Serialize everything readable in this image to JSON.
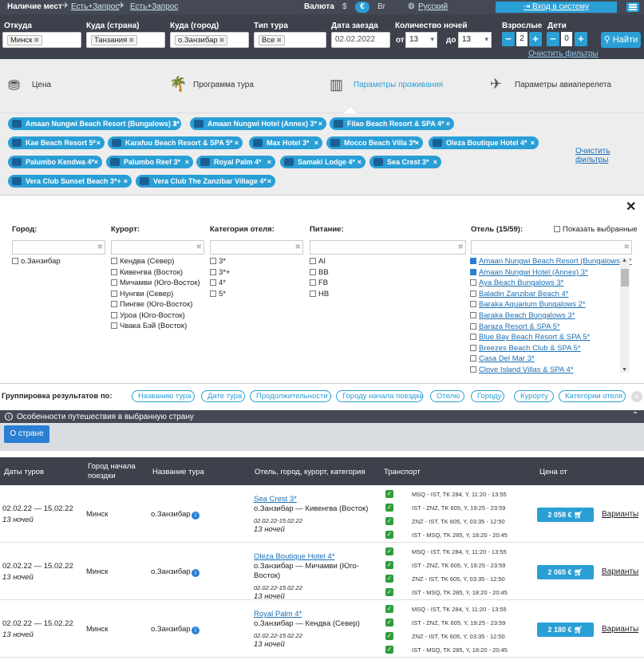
{
  "topbar": {
    "availability_label": "Наличие мест",
    "avail1": "Есть+Запрос",
    "avail2": "Есть+Запрос",
    "currency_label": "Валюта",
    "cur_usd": "$",
    "cur_eur": "€",
    "cur_br": "Br",
    "language": "Русский",
    "login": "Вход в систему"
  },
  "filters": {
    "from_label": "Откуда",
    "from_value": "Минск",
    "country_label": "Куда (страна)",
    "country_value": "Танзания",
    "city_label": "Куда (город)",
    "city_value": "о.Занзибар",
    "tour_type_label": "Тип тура",
    "tour_type_value": "Все",
    "date_label": "Дата заезда",
    "date_value": "02.02.2022",
    "nights_label": "Количество ночей",
    "nights_from_label": "от",
    "nights_from": "13",
    "nights_to_label": "до",
    "nights_to": "13",
    "adults_label": "Взрослые",
    "adults_value": "2",
    "children_label": "Дети",
    "children_value": "0",
    "minus": "−",
    "plus": "+",
    "find": "Найти",
    "clear": "Очистить фильтры"
  },
  "tabs": [
    {
      "label": "Цена"
    },
    {
      "label": "Программа тура"
    },
    {
      "label": "Параметры проживания"
    },
    {
      "label": "Параметры авиаперелета"
    }
  ],
  "hotel_tags": [
    "Amaan Nungwi Beach Resort (Bungalows) 3*",
    "Amaan Nungwi Hotel (Annex) 3*",
    "Filao Beach Resort & SPA 4*",
    "Kae Beach Resort 5*",
    "Karafuu Beach Resort & SPA 5*",
    "Max Hotel 3*",
    "Mocco Beach Villa 3*",
    "Oleza Boutique Hotel 4*",
    "Palumbo Kendwa 4*",
    "Palumbo Reef 3*",
    "Royal Palm 4*",
    "Samaki Lodge 4*",
    "Sea Crest 3*",
    "Vera Club Sunset Beach 3*+",
    "Vera Club The Zanzibar Village 4*"
  ],
  "tag_close": "×",
  "clear_filters": "Очистить фильтры",
  "panel": {
    "close": "✕",
    "city_label": "Город:",
    "cities": [
      "о.Занзибар"
    ],
    "resort_label": "Курорт:",
    "resorts": [
      "Кендва (Север)",
      "Кивенгва (Восток)",
      "Мичамви (Юго-Восток)",
      "Нунгви (Север)",
      "Пингве (Юго-Восток)",
      "Уроа (Юго-Восток)",
      "Чвака Бэй (Восток)"
    ],
    "category_label": "Категория отеля:",
    "categories": [
      "3*",
      "3*+",
      "4*",
      "5*"
    ],
    "meal_label": "Питание:",
    "meals": [
      "AI",
      "BB",
      "FB",
      "HB"
    ],
    "hotel_label": "Отель (15/59):",
    "show_selected": "Показать выбранные",
    "hotels": [
      "Amaan Nungwi Beach Resort (Bungalows) 3*",
      "Amaan Nungwi Hotel (Annex) 3*",
      "Aya Beach Bungalows 3*",
      "Baladin Zanzibar Beach 4*",
      "Baraka Aquarium Bungalows 2*",
      "Baraka Beach Bungalows 3*",
      "Baraza Resort & SPA 5*",
      "Blue Bay Beach Resort & SPA 5*",
      "Breezes Beach Club & SPA 5*",
      "Casa Del Mar 3*",
      "Clove Island Villas & SPA 4*"
    ]
  },
  "grouping": {
    "label": "Группировка результатов по:",
    "options": [
      "Названию тура",
      "Дате тура",
      "Продолжительности",
      "Городу начала поездки",
      "Отелю",
      "Городу",
      "Курорту",
      "Категории отеля"
    ]
  },
  "features": {
    "title": "Особенности путешествия в выбранную страну",
    "button": "О стране"
  },
  "table": {
    "headers": {
      "dates": "Даты туров",
      "city": "Город начала\nпоездки",
      "tour": "Название тура",
      "hotel": "Отель, город, курорт, категория",
      "transport": "Транспорт",
      "price": "Цена от"
    },
    "rows": [
      {
        "dates": "02.02.22 — 15.02.22",
        "nights": "13 ночей",
        "city": "Минск",
        "tour": "о.Занзибар",
        "hotel": "Sea Crest 3*",
        "loc1": "о.Занзибар  —  Кивенгва (Восток)",
        "loc2": "",
        "hdates": "02.02.22-15.02.22",
        "hnights": "13 ночей",
        "flights": [
          "MSQ - IST, TK 284, Y, 11:20 - 13:55",
          "IST - ZNZ, TK 605, Y, 19:25 - 23:59",
          "ZNZ - IST, TK 605, Y, 03:35 - 12:50",
          "IST - MSQ, TK 285, Y, 18:20 - 20:45"
        ],
        "price": "2 058 €",
        "variants": "Варианты"
      },
      {
        "dates": "02.02.22 — 15.02.22",
        "nights": "13 ночей",
        "city": "Минск",
        "tour": "о.Занзибар",
        "hotel": "Oleza Boutique Hotel 4*",
        "loc1": "о.Занзибар  —  Мичамви (Юго-",
        "loc2": "Восток)",
        "hdates": "02.02.22-15.02.22",
        "hnights": "13 ночей",
        "flights": [
          "MSQ - IST, TK 284, Y, 11:20 - 13:55",
          "IST - ZNZ, TK 605, Y, 19:25 - 23:59",
          "ZNZ - IST, TK 605, Y, 03:35 - 12:50",
          "IST - MSQ, TK 285, Y, 18:20 - 20:45"
        ],
        "price": "2 065 €",
        "variants": "Варианты"
      },
      {
        "dates": "02.02.22 — 15.02.22",
        "nights": "13 ночей",
        "city": "Минск",
        "tour": "о.Занзибар",
        "hotel": "Royal Palm 4*",
        "loc1": "о.Занзибар  —  Кендва (Север)",
        "loc2": "",
        "hdates": "02.02.22-15.02.22",
        "hnights": "13 ночей",
        "flights": [
          "MSQ - IST, TK 284, Y, 11:20 - 13:55",
          "IST - ZNZ, TK 605, Y, 19:25 - 23:59",
          "ZNZ - IST, TK 605, Y, 03:35 - 12:50",
          "IST - MSQ, TK 285, Y, 18:20 - 20:45"
        ],
        "price": "2 180 €",
        "variants": "Варианты"
      }
    ]
  }
}
